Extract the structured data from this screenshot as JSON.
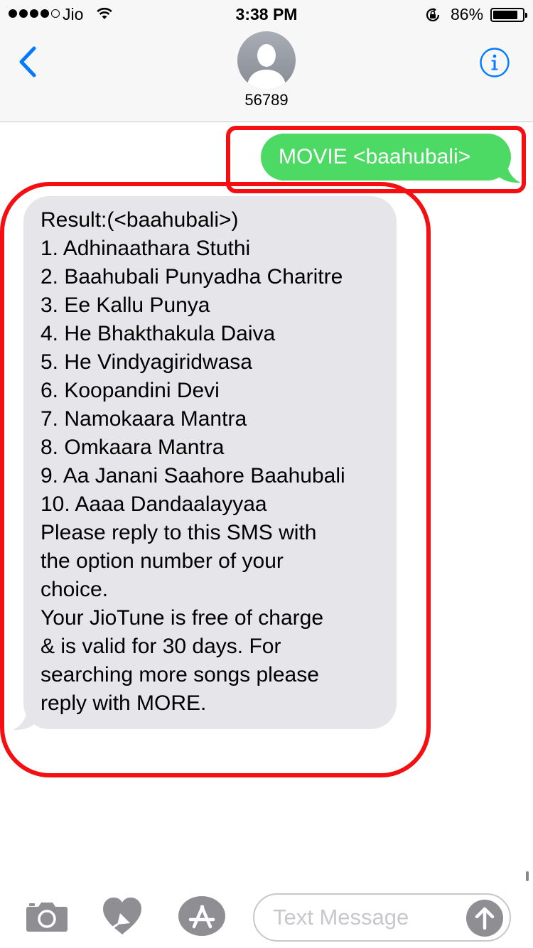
{
  "status_bar": {
    "carrier": "Jio",
    "time": "3:38 PM",
    "battery_percent": "86%",
    "battery_level": 0.86,
    "signal_bars_filled": 4,
    "signal_bars_total": 5
  },
  "nav": {
    "contact_name": "56789",
    "icons": {
      "back": "chevron-left-icon",
      "info": "info-icon",
      "avatar": "person-silhouette-icon"
    }
  },
  "messages": {
    "outgoing": {
      "text": "MOVIE <baahubali>"
    },
    "incoming": {
      "lines": [
        "Result:(<baahubali>)",
        "1. Adhinaathara Stuthi",
        "2. Baahubali Punyadha Charitre",
        "3. Ee Kallu Punya",
        "4. He Bhakthakula Daiva",
        "5. He Vindyagiridwasa",
        "6. Koopandini Devi",
        "7. Namokaara Mantra",
        "8. Omkaara Mantra",
        "9. Aa Janani Saahore Baahubali",
        "10. Aaaa Dandaalayyaa",
        "Please reply to this SMS with",
        "the option number of your",
        "choice.",
        "Your JioTune is free of charge",
        "& is valid for 30 days. For",
        "searching more songs please",
        "reply with MORE."
      ]
    }
  },
  "input_bar": {
    "placeholder": "Text Message",
    "icons": {
      "camera": "camera-icon",
      "digital_touch": "digital-touch-heart-icon",
      "app_store": "app-store-icon",
      "send": "send-arrow-up-icon"
    }
  },
  "colors": {
    "outgoing_bubble": "#4cd964",
    "incoming_bubble": "#e5e5ea",
    "ios_blue": "#007aff",
    "annotation_red": "#f40f12"
  }
}
